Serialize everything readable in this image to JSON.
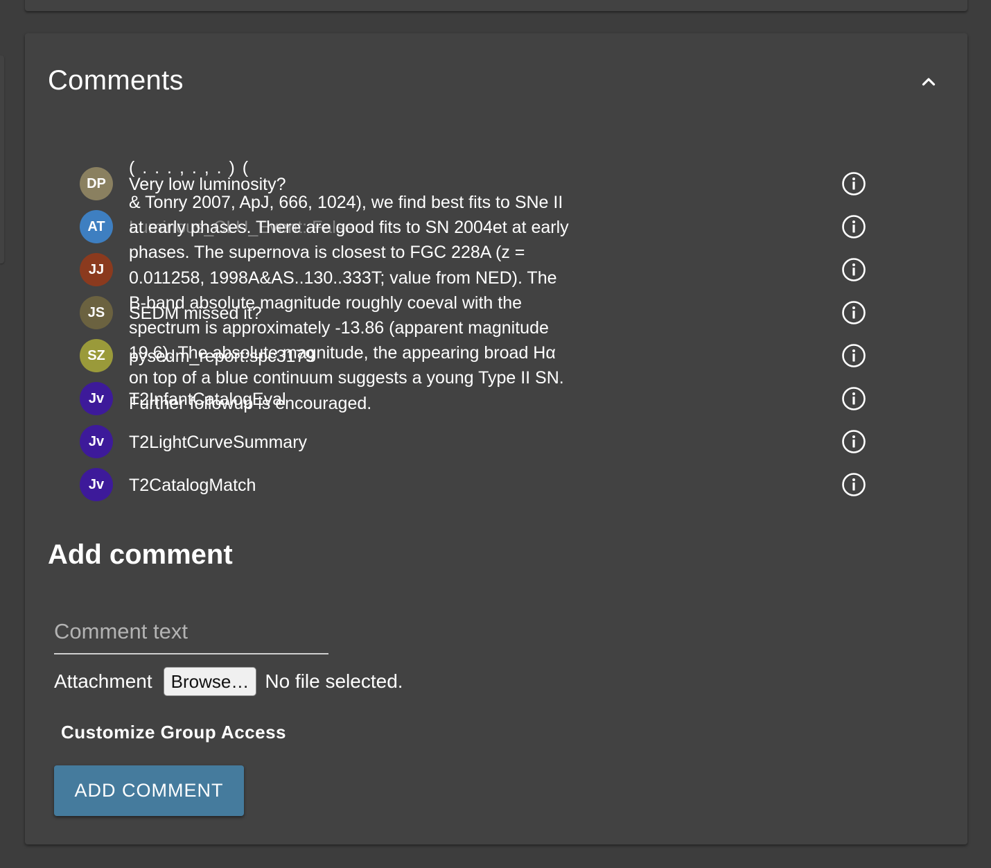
{
  "panel": {
    "title": "Comments"
  },
  "comments": [
    {
      "initials": "DP",
      "text": "Very low luminosity?",
      "color": "#8a8060",
      "faded": false
    },
    {
      "initials": "AT",
      "text": "Luminous_CLU_Event: False",
      "color": "#3e7fc1",
      "faded": true
    },
    {
      "initials": "JJ",
      "text": "",
      "color": "#8b3a1e",
      "faded": false
    },
    {
      "initials": "JS",
      "text": "SEDM missed it?",
      "color": "#6b6240",
      "faded": false
    },
    {
      "initials": "SZ",
      "text": "pysedm_report:spc3179",
      "color": "#9a9a3a",
      "faded": false
    },
    {
      "initials": "Jv",
      "text": "T2InfantCatalogEval",
      "color": "#3d1a9a",
      "faded": false
    },
    {
      "initials": "Jv",
      "text": "T2LightCurveSummary",
      "color": "#3d1a9a",
      "faded": false
    },
    {
      "initials": "Jv",
      "text": "T2CatalogMatch",
      "color": "#3d1a9a",
      "faded": false
    }
  ],
  "long_comment": {
    "fragment": "( . . . , . , . ) (",
    "text": "& Tonry 2007, ApJ, 666, 1024), we find best fits to SNe II at early phases. There are good fits to SN 2004et at early phases. The supernova is closest to FGC 228A (z = 0.011258, 1998A&AS..130..333T; value from NED). The B-band absolute magnitude roughly coeval with the spectrum is approximately -13.86 (apparent magnitude 19.6). The absolute magnitude, the appearing broad Hα on top of a blue continuum suggests a young Type II SN. Further followup is encouraged."
  },
  "add_comment": {
    "heading": "Add comment",
    "placeholder": "Comment text",
    "attachment_label": "Attachment",
    "browse_label": "Browse…",
    "no_file_label": "No file selected.",
    "customize_label": "Customize Group Access",
    "submit_label": "ADD COMMENT"
  },
  "colors": {
    "page_bg": "#3d3d3d",
    "panel_bg": "#424242",
    "accent": "#457b9d"
  }
}
